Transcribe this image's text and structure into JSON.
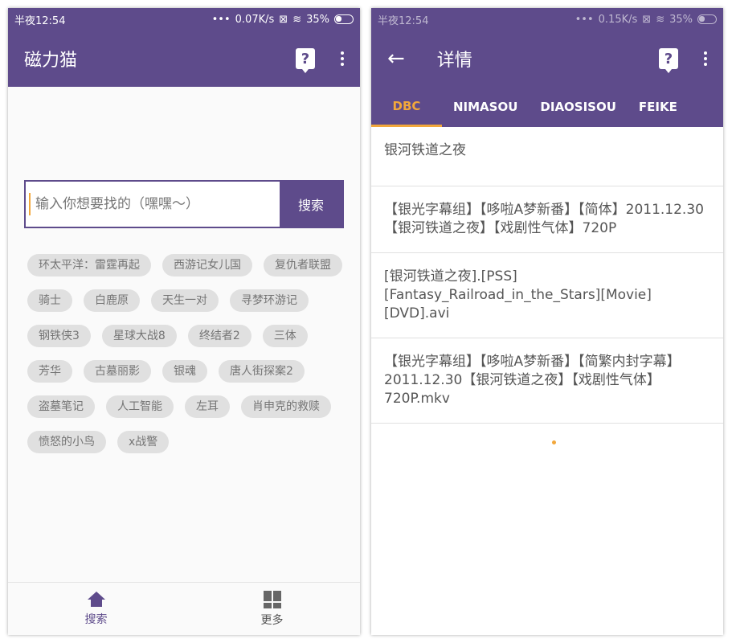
{
  "left": {
    "status": {
      "time": "半夜12:54",
      "speed": "0.07K/s",
      "battery": "35%"
    },
    "appbar": {
      "title": "磁力猫",
      "help_icon": "?"
    },
    "search": {
      "placeholder": "输入你想要找的（嘿嘿～）",
      "button": "搜索"
    },
    "tags": [
      "环太平洋：雷霆再起",
      "西游记女儿国",
      "复仇者联盟",
      "骑士",
      "白鹿原",
      "天生一对",
      "寻梦环游记",
      "钢铁侠3",
      "星球大战8",
      "终结者2",
      "三体",
      "芳华",
      "古墓丽影",
      "银魂",
      "唐人街探案2",
      "盗墓笔记",
      "人工智能",
      "左耳",
      "肖申克的救赎",
      "愤怒的小鸟",
      "x战警"
    ],
    "nav": {
      "search_label": "搜索",
      "more_label": "更多"
    }
  },
  "right": {
    "status": {
      "time": "半夜12:54",
      "speed": "0.15K/s",
      "battery": "35%"
    },
    "appbar": {
      "title": "详情",
      "back": "←",
      "help_icon": "?"
    },
    "tabs": [
      "DBC",
      "NIMASOU",
      "DIAOSISOU",
      "FEIKE"
    ],
    "results": [
      "银河铁道之夜",
      "【银光字幕组】【哆啦A梦新番】【简体】2011.12.30【银河铁道之夜】【戏剧性气体】720P",
      "[银河铁道之夜].[PSS][Fantasy_Railroad_in_the_Stars][Movie][DVD].avi",
      "【银光字幕组】【哆啦A梦新番】【简繁内封字幕】2011.12.30【银河铁道之夜】【戏剧性气体】720P.mkv"
    ]
  },
  "colors": {
    "primary": "#5e4b8b",
    "accent": "#f2a73b"
  }
}
